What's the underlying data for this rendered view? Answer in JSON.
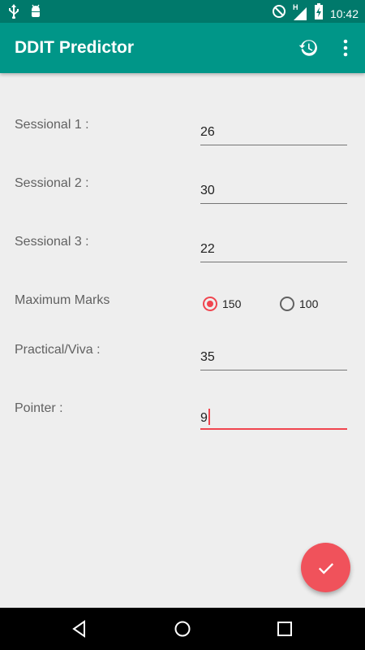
{
  "status_bar": {
    "time": "10:42",
    "left_icons": [
      "usb-icon",
      "android-debug-icon"
    ],
    "right_icons": [
      "do-not-disturb-icon",
      "signal-h-icon",
      "battery-charging-icon"
    ],
    "network_label": "H"
  },
  "app_bar": {
    "title": "DDIT Predictor",
    "actions": [
      "history-icon",
      "overflow-menu-icon"
    ]
  },
  "form": {
    "sessional1": {
      "label": "Sessional 1 :",
      "value": "26"
    },
    "sessional2": {
      "label": "Sessional 2 :",
      "value": "30"
    },
    "sessional3": {
      "label": "Sessional 3 :",
      "value": "22"
    },
    "max_marks": {
      "label": "Maximum Marks",
      "options": [
        {
          "label": "150",
          "selected": true
        },
        {
          "label": "100",
          "selected": false
        }
      ]
    },
    "practical": {
      "label": "Practical/Viva :",
      "value": "35"
    },
    "pointer": {
      "label": "Pointer :",
      "value": "9"
    }
  },
  "fab": {
    "icon": "check-icon"
  },
  "nav_bar": {
    "icons": [
      "back-icon",
      "home-icon",
      "recents-icon"
    ]
  },
  "colors": {
    "status_bar": "#00796b",
    "app_bar": "#009688",
    "accent": "#f0454f",
    "background": "#eeeeee"
  }
}
